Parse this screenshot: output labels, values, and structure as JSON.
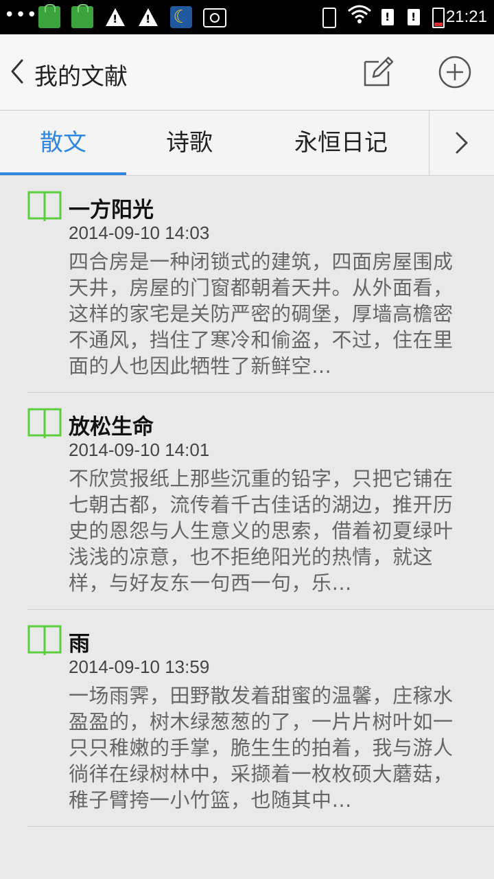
{
  "status_bar": {
    "time": "21:21",
    "icons": [
      "overflow-dots-icon",
      "shopping-bag-icon",
      "shopping-bag-icon",
      "warning-icon",
      "warning-icon",
      "moon-icon",
      "screenshot-icon",
      "phone-vibrate-icon",
      "wifi-icon",
      "sim-alert-icon",
      "sim-alert-icon",
      "battery-low-icon"
    ]
  },
  "header": {
    "title": "我的文献",
    "back_icon": "chevron-left-icon",
    "edit_icon": "edit-icon",
    "add_icon": "plus-circle-icon"
  },
  "tabs": {
    "items": [
      {
        "label": "散文",
        "active": true
      },
      {
        "label": "诗歌",
        "active": false
      },
      {
        "label": "永恒日记",
        "active": false
      }
    ],
    "more_icon": "chevron-right-icon",
    "accent_color": "#2f86e0"
  },
  "articles": [
    {
      "title": "一方阳光",
      "date": "2014-09-10 14:03",
      "excerpt": "四合房是一种闭锁式的建筑，四面房屋围成天井，房屋的门窗都朝着天井。从外面看，这样的家宅是关防严密的碉堡，厚墙高檐密不通风，挡住了寒冷和偷盗，不过，住在里面的人也因此牺牲了新鲜空…"
    },
    {
      "title": "放松生命",
      "date": "2014-09-10 14:01",
      "excerpt": "不欣赏报纸上那些沉重的铅字，只把它铺在七朝古都，流传着千古佳话的湖边，推开历史的恩怨与人生意义的思索，借着初夏绿叶浅浅的凉意，也不拒绝阳光的热情，就这样，与好友东一句西一句，乐…"
    },
    {
      "title": "雨",
      "date": "2014-09-10 13:59",
      "excerpt": "一场雨霁，田野散发着甜蜜的温馨，庄稼水盈盈的，树木绿葱葱的了，一片片树叶如一只只稚嫩的手掌，脆生生的拍着，我与游人徜徉在绿树林中，采撷着一枚枚硕大蘑菇，稚子臂挎一小竹篮，也随其中…"
    }
  ],
  "book_icon_color": "#5ccd3c"
}
